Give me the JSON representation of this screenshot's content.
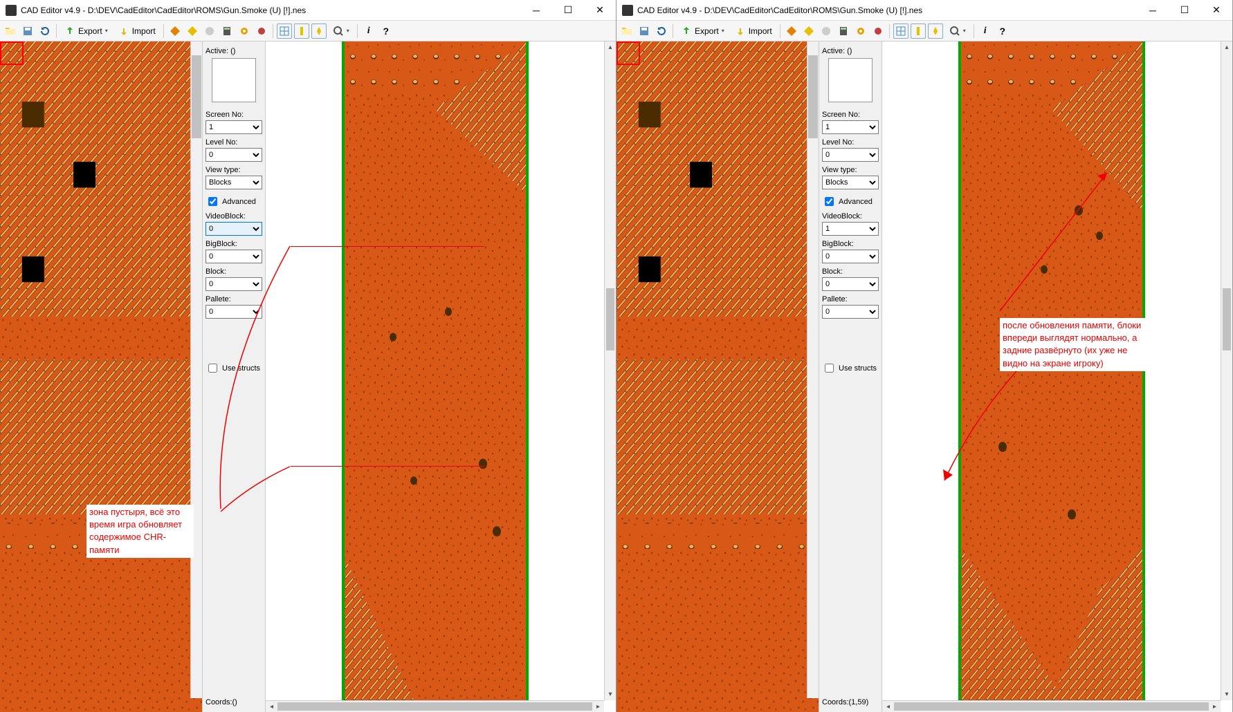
{
  "app": {
    "title": "CAD Editor v4.9 - D:\\DEV\\CadEditor\\CadEditor\\ROMS\\Gun.Smoke (U) [!].nes"
  },
  "toolbar": {
    "export": "Export",
    "import": "Import"
  },
  "controls": {
    "active_label": "Active: ()",
    "screen_no_label": "Screen No:",
    "screen_no": "1",
    "level_no_label": "Level No:",
    "level_no": "0",
    "view_type_label": "View type:",
    "view_type": "Blocks",
    "advanced": "Advanced",
    "videoblock_label": "VideoBlock:",
    "bigblock_label": "BigBlock:",
    "bigblock": "0",
    "block_label": "Block:",
    "block": "0",
    "pallete_label": "Pallete:",
    "pallete": "0",
    "use_structs": "Use structs"
  },
  "instances": [
    {
      "videoblock": "0",
      "coords": "Coords:()",
      "annotation": "зона пустыря, всё это время игра обновляет содержимое CHR-памяти",
      "annotation_style": "left",
      "red_box_lines": true
    },
    {
      "videoblock": "1",
      "coords": "Coords:(1,59)",
      "annotation": "после обновления памяти, блоки впереди выглядят нормально, а задние развёрнуто (их уже не видно на экране игроку)",
      "annotation_style": "right",
      "red_box_lines": false
    }
  ],
  "colors": {
    "ground": "#d85818",
    "dark": "#4a2c00",
    "light": "#f8b060",
    "border_green": "#00a000",
    "anno_red": "#ee0000"
  }
}
